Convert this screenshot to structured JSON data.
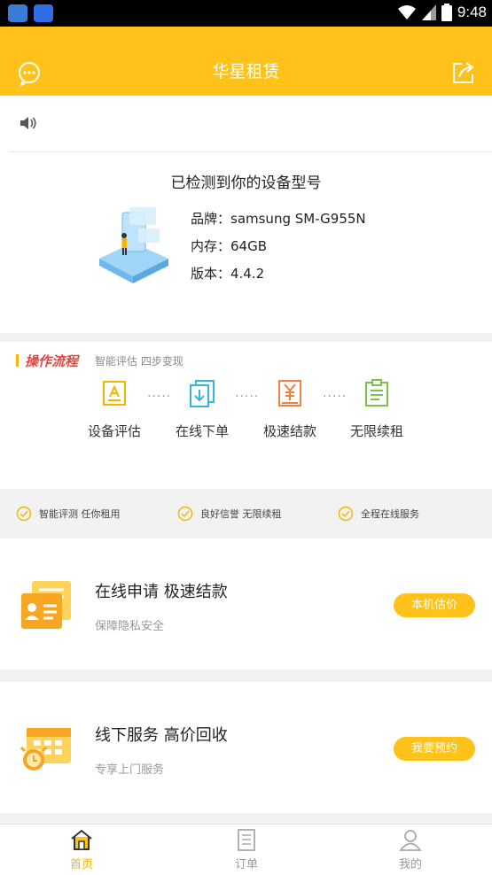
{
  "status_bar": {
    "time": "9:48"
  },
  "header": {
    "title": "华星租赁"
  },
  "device": {
    "heading": "已检测到你的设备型号",
    "brand": "品牌：samsung SM-G955N",
    "memory": "内存：64GB",
    "version": "版本：4.4.2"
  },
  "process": {
    "title": "操作流程",
    "subtitle": "智能评估  四步变现",
    "steps": [
      {
        "label": "设备评估",
        "color": "#f5b400"
      },
      {
        "label": "在线下单",
        "color": "#35b7d8"
      },
      {
        "label": "极速结款",
        "color": "#f08040"
      },
      {
        "label": "无限续租",
        "color": "#7cc24a"
      }
    ],
    "separator": "·····"
  },
  "features": [
    {
      "text": "智能评测  任你租用"
    },
    {
      "text": "良好信誉  无限续租"
    },
    {
      "text": "全程在线服务"
    }
  ],
  "services": [
    {
      "title": "在线申请  极速结款",
      "subtitle": "保障隐私安全",
      "button": "本机估价",
      "icon": "id-card-icon"
    },
    {
      "title": "线下服务  高价回收",
      "subtitle": "专享上门服务",
      "button": "我要预约",
      "icon": "calendar-alarm-icon"
    }
  ],
  "tabs": [
    {
      "label": "首页",
      "active": true,
      "icon": "home-icon"
    },
    {
      "label": "订单",
      "active": false,
      "icon": "order-icon"
    },
    {
      "label": "我的",
      "active": false,
      "icon": "profile-icon"
    }
  ],
  "colors": {
    "brand": "#ffc21a",
    "accent_text": "#ffb400",
    "process_title": "#e0483e"
  }
}
